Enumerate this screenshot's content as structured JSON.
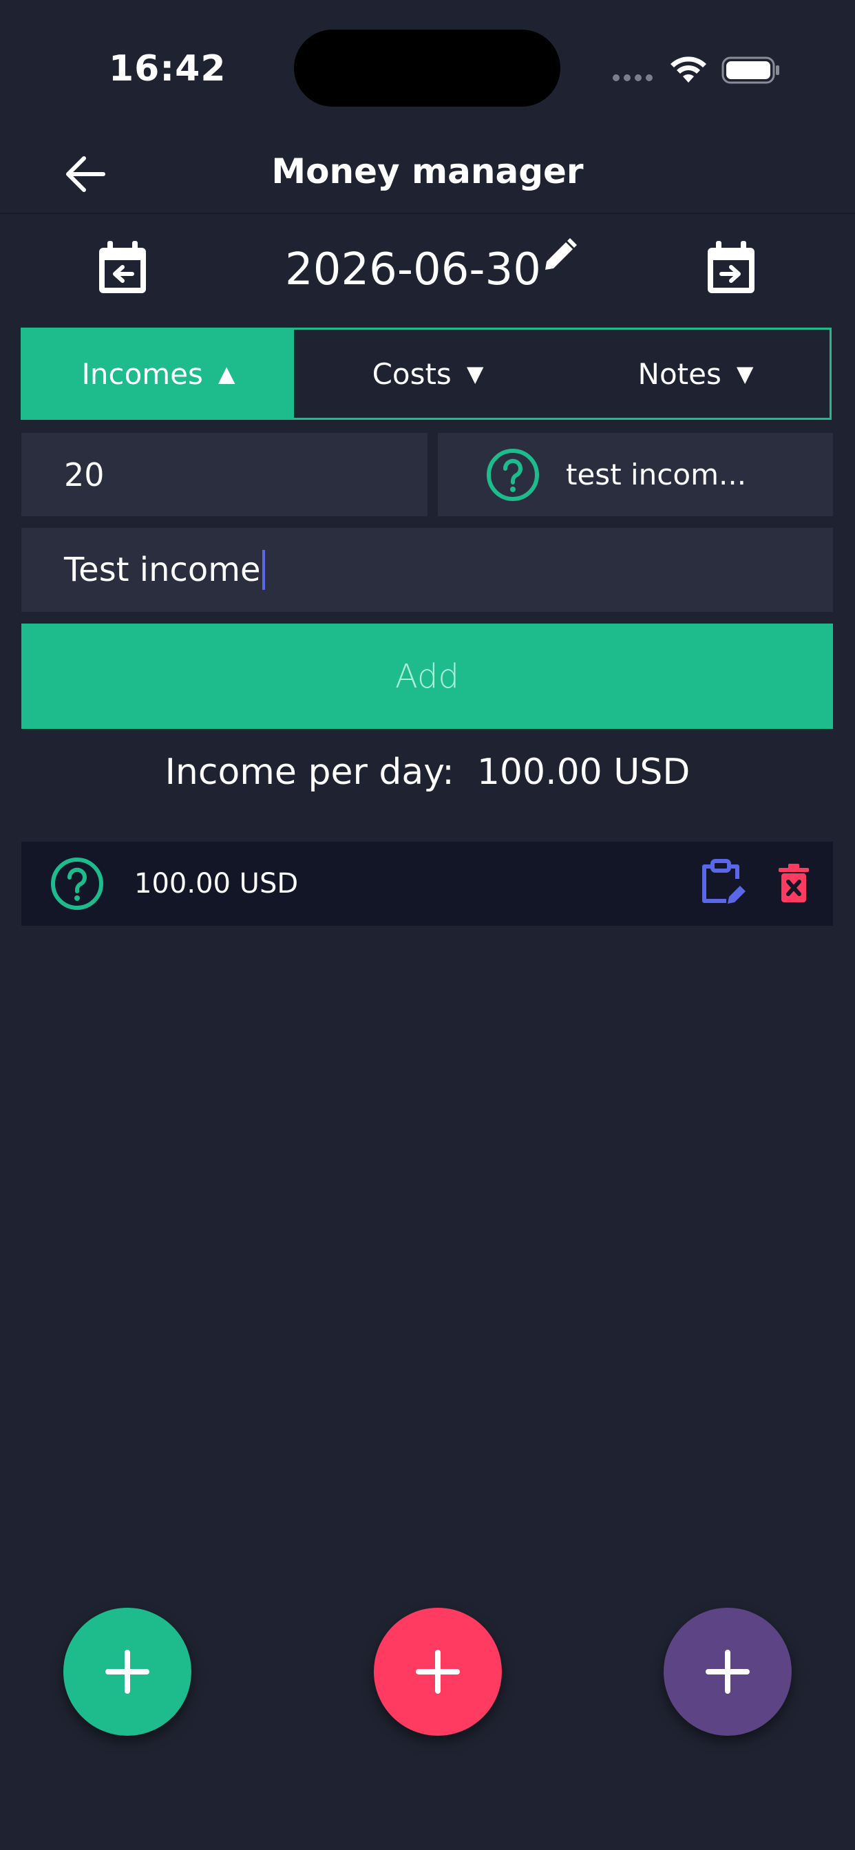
{
  "status_bar": {
    "time": "16:42"
  },
  "header": {
    "title": "Money manager"
  },
  "date_nav": {
    "date": "2026-06-30"
  },
  "tabs": [
    {
      "label": "Incomes",
      "arrow": "▲",
      "active": true
    },
    {
      "label": "Costs",
      "arrow": "▼",
      "active": false
    },
    {
      "label": "Notes",
      "arrow": "▼",
      "active": false
    }
  ],
  "form": {
    "amount_value": "20",
    "category_label": "test incom...",
    "description_value": "Test income",
    "add_label": "Add"
  },
  "summary": {
    "label": "Income per day:",
    "value": "100.00 USD"
  },
  "entries": [
    {
      "amount": "100.00 USD",
      "icon": "question-circle-icon"
    }
  ],
  "colors": {
    "background": "#1f2230",
    "accent_green": "#1ebc8c",
    "cost_red": "#ff3b61",
    "note_purple": "#5d4585",
    "edit_blue": "#5a67e6",
    "input_bg": "#2a2e3f"
  }
}
